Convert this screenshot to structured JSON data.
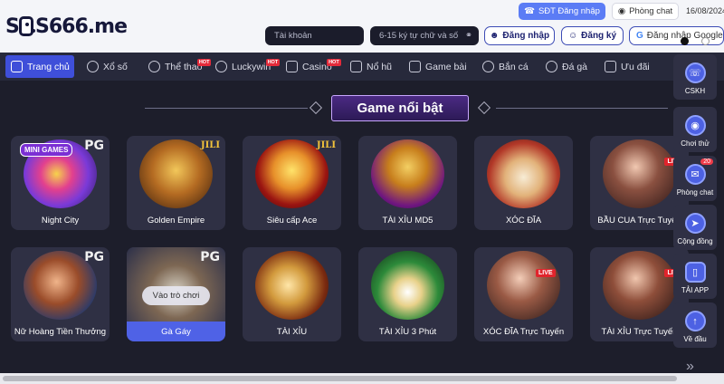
{
  "header": {
    "logo_prefix": "S",
    "logo_mid": "6",
    "logo_main": "S666",
    "logo_suffix": ".me",
    "sdt_login_label": "SĐT Đăng nhập",
    "phong_chat_label": "Phòng chat",
    "date": "16/08/2024",
    "account_placeholder": "Tài khoản",
    "password_placeholder": "6-15 ký tự chữ và số",
    "login_label": "Đăng nhập",
    "register_label": "Đăng ký",
    "google_login_label": "Đăng nhập Google"
  },
  "nav": {
    "items": [
      {
        "label": "Trang chủ",
        "icon": "home-icon",
        "active": true,
        "hot": false
      },
      {
        "label": "Xổ số",
        "icon": "lottery-icon",
        "active": false,
        "hot": false
      },
      {
        "label": "Thể thao",
        "icon": "sports-icon",
        "active": false,
        "hot": true
      },
      {
        "label": "Luckywin",
        "icon": "luckywin-icon",
        "active": false,
        "hot": true
      },
      {
        "label": "Casino",
        "icon": "casino-icon",
        "active": false,
        "hot": true
      },
      {
        "label": "Nổ hũ",
        "icon": "slot-icon",
        "active": false,
        "hot": false
      },
      {
        "label": "Game bài",
        "icon": "cards-icon",
        "active": false,
        "hot": false
      },
      {
        "label": "Bắn cá",
        "icon": "fish-icon",
        "active": false,
        "hot": false
      },
      {
        "label": "Đá gà",
        "icon": "rooster-icon",
        "active": false,
        "hot": false
      },
      {
        "label": "Ưu đãi",
        "icon": "gift-icon",
        "active": false,
        "hot": false
      }
    ],
    "hot_label": "HOT"
  },
  "section": {
    "title": "Game nổi bật"
  },
  "games": [
    {
      "label": "Night City",
      "provider": "PG",
      "badge_text": "MINI GAMES"
    },
    {
      "label": "Golden Empire",
      "provider": "JILI"
    },
    {
      "label": "Siêu cấp Ace",
      "provider": "JILI"
    },
    {
      "label": "TÀI XỈU MD5",
      "provider": ""
    },
    {
      "label": "XÓC ĐĨA",
      "provider": ""
    },
    {
      "label": "BẦU CUA Trực Tuyến",
      "provider": "",
      "live": "LIVE"
    },
    {
      "label": "Nữ Hoàng Tiền Thưởng",
      "provider": "PG"
    },
    {
      "label": "Gà Gáy",
      "provider": "PG",
      "overlay": "Vào trò chơi"
    },
    {
      "label": "TÀI XỈU",
      "provider": ""
    },
    {
      "label": "TÀI XỈU 3 Phút",
      "provider": ""
    },
    {
      "label": "XÓC ĐĨA Trực Tuyến",
      "provider": "",
      "live": "LIVE"
    },
    {
      "label": "TÀI XỈU Trực Tuyến",
      "provider": "",
      "live": "LIVE"
    }
  ],
  "sidebar": {
    "items": [
      {
        "label": "CSKH",
        "icon": "headset-icon"
      },
      {
        "label": "Chơi thử",
        "icon": "gamepad-icon"
      },
      {
        "label": "Phòng chat",
        "icon": "chat-icon",
        "badge": "20"
      },
      {
        "label": "Cộng đồng",
        "icon": "telegram-icon"
      },
      {
        "label": "TẢI APP",
        "icon": "phone-icon"
      },
      {
        "label": "Về đầu",
        "icon": "arrow-up-icon"
      }
    ]
  },
  "colors": {
    "background": "#1d1e2b",
    "accent": "#3f4fd9",
    "card": "#2f3044",
    "hot": "#e42a3a",
    "title_border": "#c9a7ff"
  }
}
